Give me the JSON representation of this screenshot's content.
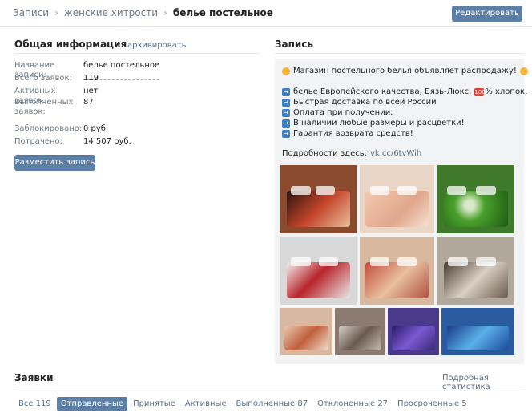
{
  "breadcrumb": {
    "items": [
      "Записи",
      "женские хитрости",
      "белье постельное"
    ]
  },
  "header": {
    "edit_button": "Редактировать"
  },
  "general": {
    "title": "Общая информация",
    "archive_link": "архивировать",
    "rows": [
      {
        "label": "Название записи:",
        "value": "белье постельное"
      },
      {
        "label": "Всего заявок:",
        "value": "119"
      },
      {
        "label": "Активных заявок:",
        "value": "нет"
      },
      {
        "label": "Выполненных заявок:",
        "value": "87"
      },
      {
        "label": "Заблокировано:",
        "value": "0 руб."
      },
      {
        "label": "Потрачено:",
        "value": "14 507 руб."
      }
    ],
    "place_button": "Разместить запись"
  },
  "post": {
    "title": "Запись",
    "headline": "Магазин постельного белья объявляет распродажу!",
    "bullets": [
      {
        "before": "белье Европейского качества, Бязь-Люкс,",
        "badge": "100",
        "after": "% хлопок."
      },
      {
        "text": "Быстрая доставка по всей России"
      },
      {
        "text": "Оплата при получении."
      },
      {
        "text": "В наличии любые размеры и расцветки!"
      },
      {
        "text": "Гарантия возврата средств!"
      }
    ],
    "details_label": "Подробности здесь:",
    "details_link": "vk.cc/6tvWih"
  },
  "requests": {
    "title": "Заявки",
    "stats_link": "Подробная статистика",
    "tabs": [
      "Все 119",
      "Отправленные",
      "Принятые",
      "Активные",
      "Выполненные 87",
      "Отклоненные 27",
      "Просроченные 5"
    ],
    "active_tab": "Отправленные"
  },
  "colors": {
    "accent": "#5b7fa6",
    "link": "#5b6f84",
    "panel": "#f2f3f5"
  }
}
